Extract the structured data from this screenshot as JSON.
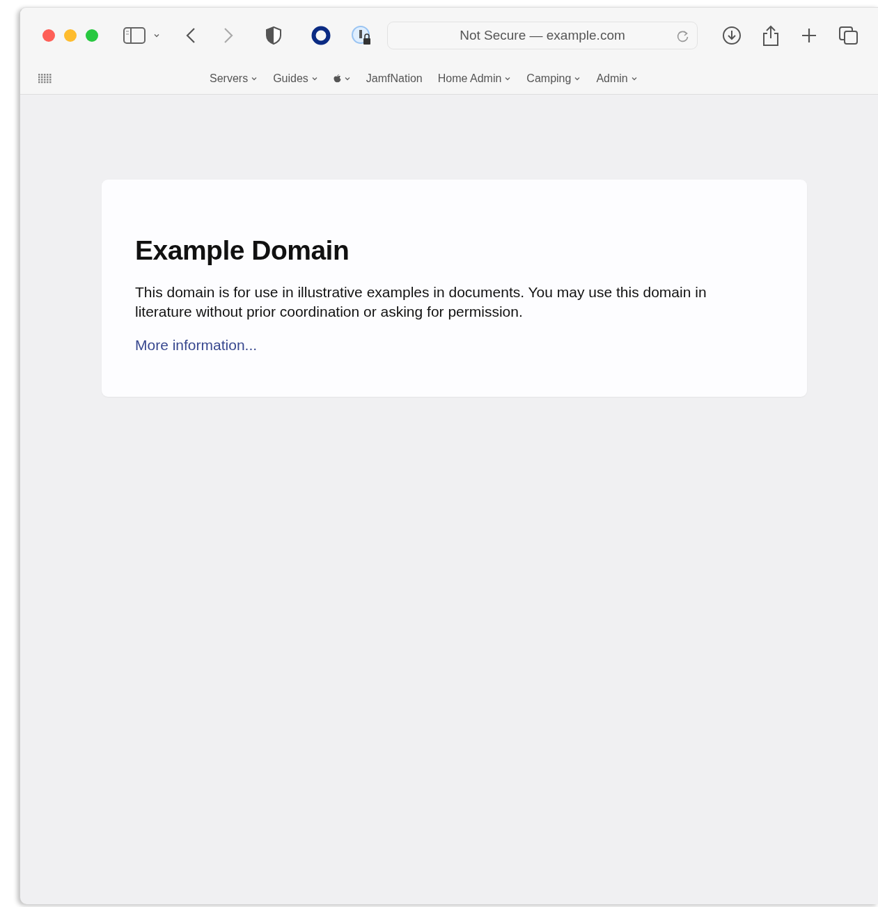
{
  "address_bar": {
    "text": "Not Secure — example.com"
  },
  "favorites": [
    {
      "kind": "text",
      "label": "Servers",
      "has_menu": true
    },
    {
      "kind": "text",
      "label": "Guides",
      "has_menu": true
    },
    {
      "kind": "apple",
      "has_menu": true
    },
    {
      "kind": "text",
      "label": "JamfNation",
      "has_menu": false
    },
    {
      "kind": "text",
      "label": "Home Admin",
      "has_menu": true
    },
    {
      "kind": "text",
      "label": "Camping",
      "has_menu": true
    },
    {
      "kind": "text",
      "label": "Admin",
      "has_menu": true
    }
  ],
  "page": {
    "title": "Example Domain",
    "body": "This domain is for use in illustrative examples in documents. You may use this domain in literature without prior coordination or asking for permission.",
    "link": "More information..."
  }
}
